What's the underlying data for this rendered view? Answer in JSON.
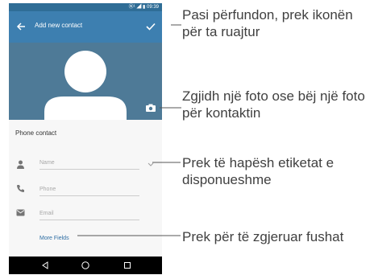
{
  "status_bar": {
    "signal": "Ⓝ¹",
    "time": "09:39"
  },
  "app_bar": {
    "title": "Add new contact",
    "back_icon": "arrow-left-icon",
    "save_icon": "check-icon"
  },
  "photo": {
    "background_color": "#4e7a97",
    "camera_icon": "camera-icon"
  },
  "form": {
    "section_label": "Phone contact",
    "fields": [
      {
        "icon": "person-icon",
        "placeholder": "Name"
      },
      {
        "icon": "phone-icon",
        "placeholder": "Phone"
      },
      {
        "icon": "email-icon",
        "placeholder": "Email"
      }
    ],
    "more_fields": "More Fields"
  },
  "nav_bar": {
    "back": "triangle-back-icon",
    "home": "circle-home-icon",
    "recents": "square-recents-icon"
  },
  "callouts": [
    {
      "text": "Pasi përfundon, prek ikonën për ta ruajtur"
    },
    {
      "text": "Zgjidh një foto ose bëj një foto për kontaktin"
    },
    {
      "text": "Prek të hapësh etiketat e disponueshme"
    },
    {
      "text": "Prek për të zgjeruar fushat"
    }
  ],
  "colors": {
    "app_bar": "#3d7fb0",
    "status_bar": "#2f6d96",
    "link": "#2d6da3"
  }
}
